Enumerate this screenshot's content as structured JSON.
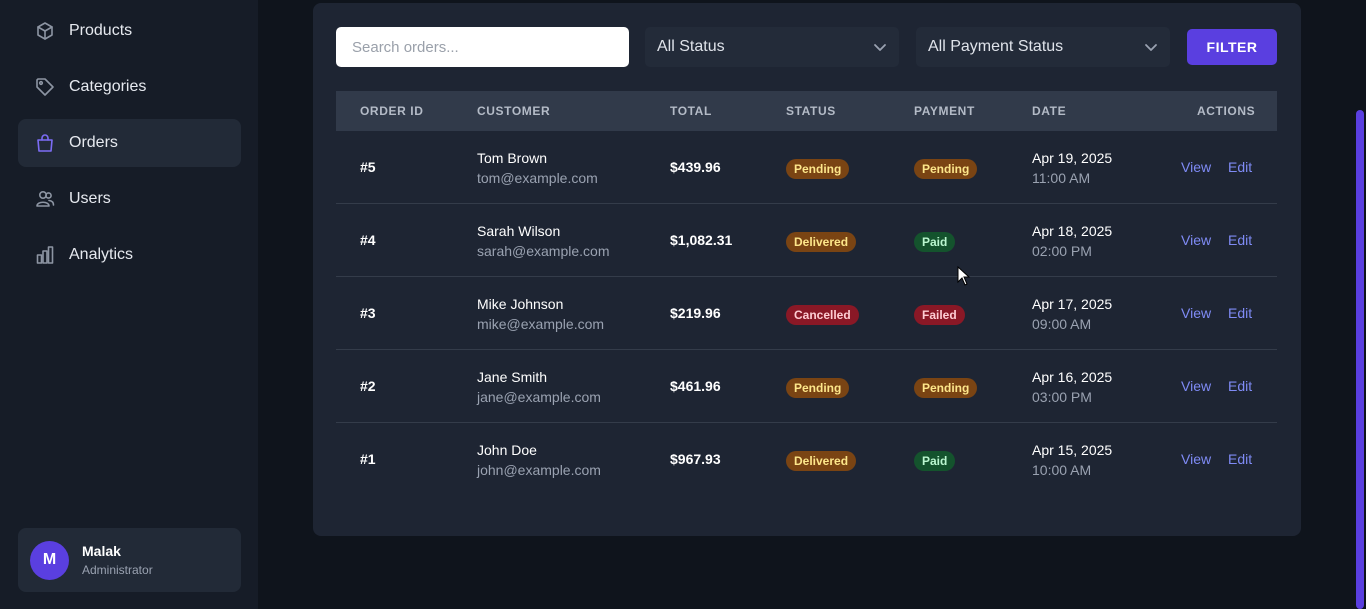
{
  "sidebar": {
    "items": [
      {
        "label": "Products",
        "icon": "box-icon"
      },
      {
        "label": "Categories",
        "icon": "tag-icon"
      },
      {
        "label": "Orders",
        "icon": "shopping-bag-icon",
        "active": true
      },
      {
        "label": "Users",
        "icon": "users-icon"
      },
      {
        "label": "Analytics",
        "icon": "bar-chart-icon"
      }
    ],
    "user": {
      "initial": "M",
      "name": "Malak",
      "role": "Administrator"
    }
  },
  "filters": {
    "search_placeholder": "Search orders...",
    "status": "All Status",
    "payment_status": "All Payment Status",
    "filter_label": "FILTER"
  },
  "table": {
    "headers": {
      "order_id": "ORDER ID",
      "customer": "CUSTOMER",
      "total": "TOTAL",
      "status": "STATUS",
      "payment": "PAYMENT",
      "date": "DATE",
      "actions": "ACTIONS"
    },
    "rows": [
      {
        "id": "#5",
        "name": "Tom Brown",
        "email": "tom@example.com",
        "total": "$439.96",
        "status": "Pending",
        "payment": "Pending",
        "date": "Apr 19, 2025",
        "time": "11:00 AM",
        "view": "View",
        "edit": "Edit"
      },
      {
        "id": "#4",
        "name": "Sarah Wilson",
        "email": "sarah@example.com",
        "total": "$1,082.31",
        "status": "Delivered",
        "payment": "Paid",
        "date": "Apr 18, 2025",
        "time": "02:00 PM",
        "view": "View",
        "edit": "Edit"
      },
      {
        "id": "#3",
        "name": "Mike Johnson",
        "email": "mike@example.com",
        "total": "$219.96",
        "status": "Cancelled",
        "payment": "Failed",
        "date": "Apr 17, 2025",
        "time": "09:00 AM",
        "view": "View",
        "edit": "Edit"
      },
      {
        "id": "#2",
        "name": "Jane Smith",
        "email": "jane@example.com",
        "total": "$461.96",
        "status": "Pending",
        "payment": "Pending",
        "date": "Apr 16, 2025",
        "time": "03:00 PM",
        "view": "View",
        "edit": "Edit"
      },
      {
        "id": "#1",
        "name": "John Doe",
        "email": "john@example.com",
        "total": "$967.93",
        "status": "Delivered",
        "payment": "Paid",
        "date": "Apr 15, 2025",
        "time": "10:00 AM",
        "view": "View",
        "edit": "Edit"
      }
    ]
  },
  "colors": {
    "accent": "#5a3fe0",
    "background": "#0f141c",
    "panel": "#1e2533",
    "sidebar": "#161c27",
    "link": "#7f8bf5"
  }
}
